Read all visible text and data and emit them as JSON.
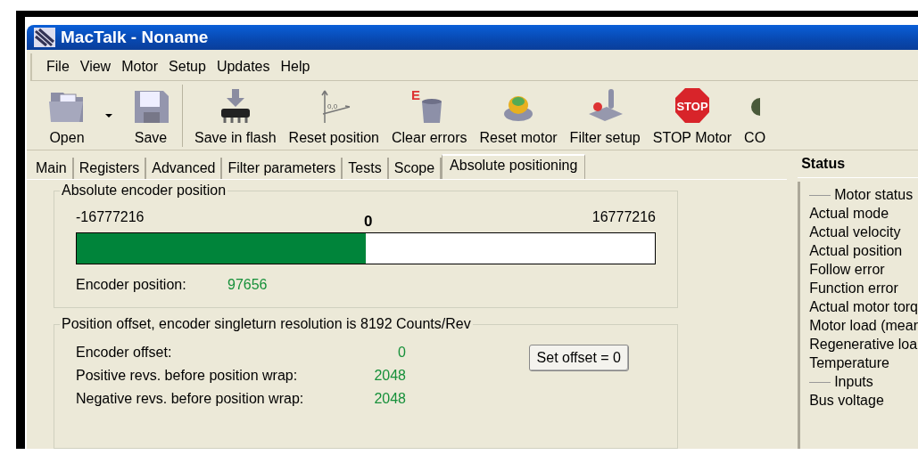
{
  "window": {
    "title": "MacTalk - Noname"
  },
  "menu": [
    "File",
    "View",
    "Motor",
    "Setup",
    "Updates",
    "Help"
  ],
  "toolbar": [
    {
      "label": "Open",
      "kind": "open"
    },
    {
      "kind": "dropdown"
    },
    {
      "label": "Save",
      "kind": "save"
    },
    {
      "kind": "separator"
    },
    {
      "label": "Save in flash",
      "kind": "flash"
    },
    {
      "label": "Reset position",
      "kind": "axes",
      "icon_text": "0,0"
    },
    {
      "label": "Clear errors",
      "kind": "clear",
      "icon_text": "E"
    },
    {
      "label": "Reset motor",
      "kind": "reset"
    },
    {
      "label": "Filter setup",
      "kind": "filter"
    },
    {
      "label": "STOP Motor",
      "kind": "stop",
      "icon_text": "STOP"
    },
    {
      "label": "CO",
      "kind": "partial"
    }
  ],
  "tabs": [
    {
      "label": "Main",
      "selected": false
    },
    {
      "label": "Registers",
      "selected": false
    },
    {
      "label": "Advanced",
      "selected": false
    },
    {
      "label": "Filter parameters",
      "selected": false
    },
    {
      "label": "Tests",
      "selected": false
    },
    {
      "label": "Scope",
      "selected": false
    },
    {
      "label": "Absolute positioning",
      "selected": true
    }
  ],
  "encoder_group": {
    "title": "Absolute encoder position",
    "min": "-16777216",
    "center": "0",
    "max": "16777216",
    "level": 0.5,
    "position_label": "Encoder position:",
    "position_value": "97656"
  },
  "offset_group": {
    "title": "Position offset, encoder singleturn resolution is 8192 Counts/Rev",
    "rows": [
      {
        "label": "Encoder offset:",
        "value": "0"
      },
      {
        "label": "Positive revs. before position wrap:",
        "value": "2048"
      },
      {
        "label": "Negative revs. before position wrap:",
        "value": "2048"
      }
    ],
    "button": "Set offset = 0"
  },
  "status": {
    "title": "Status",
    "sections": [
      {
        "title": "Motor status",
        "items": [
          "Actual mode",
          "Actual velocity",
          "Actual position",
          "Follow error",
          "Function error",
          "Actual motor torq",
          "Motor load (mear",
          "Regenerative loa",
          "Temperature"
        ]
      },
      {
        "title": "Inputs",
        "items": [
          "Bus voltage"
        ]
      }
    ]
  }
}
